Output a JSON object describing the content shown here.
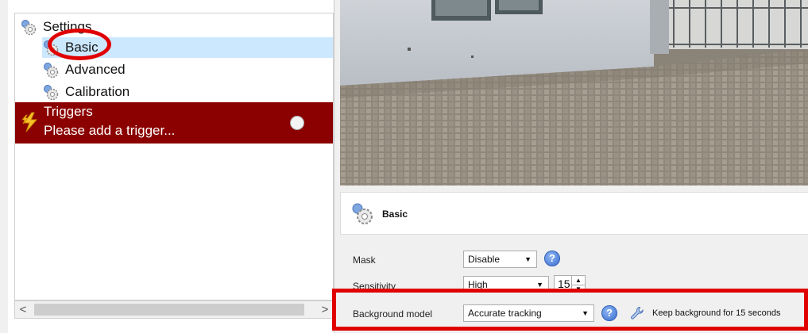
{
  "tree": {
    "settings_label": "Settings",
    "items": [
      {
        "label": "Basic",
        "selected": true
      },
      {
        "label": "Advanced",
        "selected": false
      },
      {
        "label": "Calibration",
        "selected": false
      }
    ]
  },
  "triggers": {
    "title": "Triggers",
    "message": "Please add a trigger..."
  },
  "scrollbar": {
    "left_arrow": "<",
    "right_arrow": ">"
  },
  "basic_panel": {
    "title": "Basic"
  },
  "form": {
    "mask": {
      "label": "Mask",
      "value": "Disable"
    },
    "sensitivity": {
      "label": "Sensitivity",
      "value": "High",
      "number": "15"
    },
    "background_model": {
      "label": "Background model",
      "value": "Accurate tracking",
      "keep_text": "Keep background for 15 seconds"
    }
  },
  "icons": {
    "help": "?",
    "caret": "▼",
    "spin_up": "▲",
    "spin_down": "▼"
  },
  "colors": {
    "triggers_bg": "#8b0000",
    "selection_bg": "#cce8ff",
    "annotation": "#e00000"
  }
}
